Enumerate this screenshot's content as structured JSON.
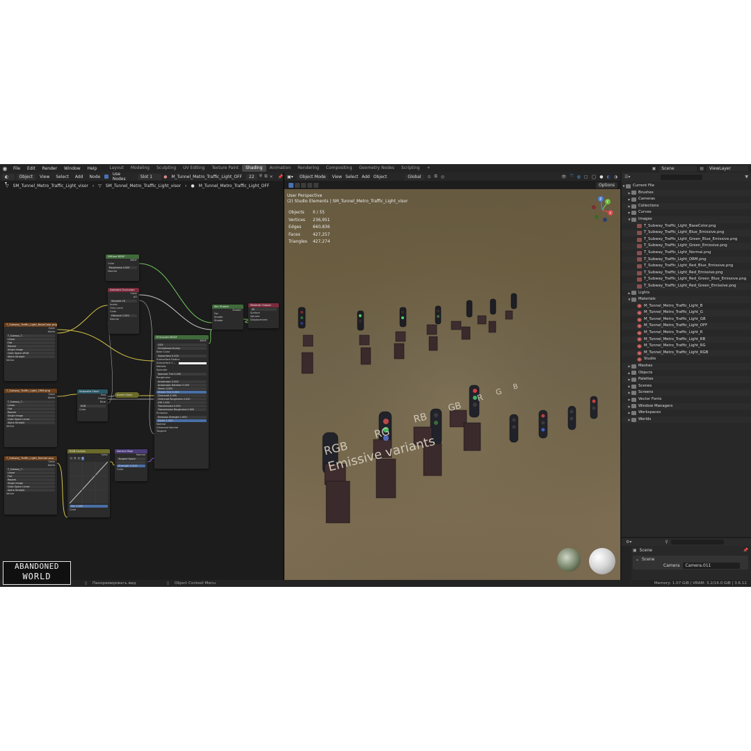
{
  "app": {
    "menus": [
      "File",
      "Edit",
      "Render",
      "Window",
      "Help"
    ],
    "workspaces": [
      "Layout",
      "Modeling",
      "Sculpting",
      "UV Editing",
      "Texture Paint",
      "Shading",
      "Animation",
      "Rendering",
      "Compositing",
      "Geometry Nodes",
      "Scripting"
    ],
    "active_workspace": "Shading",
    "add_tab": "+",
    "scene": "Scene",
    "view_layer": "ViewLayer"
  },
  "node_editor": {
    "header": {
      "mode": "Object",
      "view": "View",
      "select": "Select",
      "add": "Add",
      "node": "Node",
      "use_nodes": "Use Nodes",
      "slot": "Slot 1",
      "material": "M_Tunnel_Metro_Traffic_Light_OFF",
      "users": "22"
    },
    "breadcrumbs": [
      "SM_Tunnel_Metro_Traffic_Light_visor",
      "SM_Tunnel_Metro_Traffic_Light_visor",
      "M_Tunnel_Metro_Traffic_Light_OFF"
    ],
    "nodes": {
      "diffuse": {
        "title": "Diffuse BSDF",
        "out": "BSDF",
        "rows": [
          "Color",
          "Roughness   0.000",
          "Normal"
        ]
      },
      "ao": {
        "title": "Ambient Occlusion",
        "out1": "Color",
        "out2": "AO",
        "rows": [
          "Samples   16",
          "Inside",
          "Only Local",
          "Color",
          "Distance   1.000",
          "Normal"
        ]
      },
      "mix": {
        "title": "Mix Shader",
        "out": "Shader",
        "rows": [
          "Fac",
          "Shader",
          "Shader"
        ]
      },
      "output": {
        "title": "Material Output",
        "target": "All",
        "rows": [
          "Surface",
          "Volume",
          "Displacement"
        ]
      },
      "tex_base": {
        "title": "T_Subway_Traffic_Light_BaseColor.png",
        "out1": "Color",
        "out2": "Alpha",
        "file": "T_Subway_T...",
        "rows": [
          "Linear",
          "Flat",
          "Repeat",
          "Single Image",
          "Color Space   sRGB",
          "Alpha   Straight",
          "Vector"
        ]
      },
      "tex_orm": {
        "title": "T_Subway_Traffic_Light_ORM.png",
        "out1": "Color",
        "out2": "Alpha",
        "file": "T_Subway_T...",
        "rows": [
          "Linear",
          "Flat",
          "Repeat",
          "Single Image",
          "Color Space   Linear",
          "Alpha   Straight",
          "Vector"
        ]
      },
      "tex_normal": {
        "title": "T_Subway_Traffic_Light_Normal.png",
        "out1": "Color",
        "out2": "Alpha",
        "file": "T_Subway_T...",
        "rows": [
          "Linear",
          "Flat",
          "Repeat",
          "Single Image",
          "Color Space   Linear",
          "Alpha   Straight",
          "Vector"
        ]
      },
      "separate": {
        "title": "Separate Color",
        "rows": [
          "Red",
          "Green",
          "Blue",
          "RGB",
          "Color"
        ]
      },
      "invert": {
        "title": "Invert Color"
      },
      "rgbcurves": {
        "title": "RGB Curves",
        "out": "Color",
        "fac": "Fac   1.000",
        "color": "Color"
      },
      "normalmap": {
        "title": "Normal Map",
        "out": "Normal",
        "space": "Tangent Space",
        "strength": "Strength   1.000",
        "color": "Color"
      },
      "principled": {
        "title": "Principled BSDF",
        "out": "BSDF",
        "rows": [
          "GGX",
          "Christensen-Burley",
          "Base Color",
          "Subsurface   0.000",
          "Subsurface Radius",
          "Subsurface C...",
          "Metallic",
          "Specular",
          "Specular Tint   0.000",
          "Roughness",
          "Anisotropic   0.000",
          "Anisotropic Rotation   0.000",
          "Sheen   0.000",
          "Sheen Tint   0.500",
          "Clearcoat   0.000",
          "Clearcoat Roughness   0.030",
          "IOR   1.450",
          "Transmission   0.000",
          "Transmission Roughness   0.000",
          "Emission",
          "Emission Strength   1.000",
          "Alpha   1.000",
          "Normal",
          "Clearcoat Normal",
          "Tangent"
        ]
      }
    }
  },
  "viewport": {
    "mode": "Object Mode",
    "view": "View",
    "select": "Select",
    "add": "Add",
    "object": "Object",
    "orientation": "Global",
    "options": "Options",
    "perspective": "User Perspective",
    "collection_line": "(2) Studio Elements | SM_Tunnel_Metro_Traffic_Light_visor",
    "stats": [
      {
        "label": "Objects",
        "value": "0 / 55"
      },
      {
        "label": "Vertices",
        "value": "236,951"
      },
      {
        "label": "Edges",
        "value": "660,836"
      },
      {
        "label": "Faces",
        "value": "427,257"
      },
      {
        "label": "Triangles",
        "value": "427,274"
      }
    ],
    "scene_text": {
      "variants_top": [
        "RGB",
        "RG",
        "RB",
        "GB",
        "R",
        "G",
        "B"
      ],
      "caption": "Emissive variants"
    },
    "gizmo_axes": [
      "X",
      "Y",
      "Z"
    ]
  },
  "outliner": {
    "root": "Current File",
    "tree": [
      {
        "label": "Brushes",
        "level": 1,
        "type": "grp",
        "expanded": false
      },
      {
        "label": "Cameras",
        "level": 1,
        "type": "grp",
        "expanded": false
      },
      {
        "label": "Collections",
        "level": 1,
        "type": "grp",
        "expanded": false
      },
      {
        "label": "Curves",
        "level": 1,
        "type": "grp",
        "expanded": false
      },
      {
        "label": "Images",
        "level": 1,
        "type": "grp",
        "expanded": true
      },
      {
        "label": "T_Subway_Traffic_Light_BaseColor.png",
        "level": 2,
        "type": "img"
      },
      {
        "label": "T_Subway_Traffic_Light_Blue_Emissive.png",
        "level": 2,
        "type": "img"
      },
      {
        "label": "T_Subway_Traffic_Light_Green_Blue_Emissive.png",
        "level": 2,
        "type": "img"
      },
      {
        "label": "T_Subway_Traffic_Light_Green_Emissive.png",
        "level": 2,
        "type": "img"
      },
      {
        "label": "T_Subway_Traffic_Light_Normal.png",
        "level": 2,
        "type": "img"
      },
      {
        "label": "T_Subway_Traffic_Light_ORM.png",
        "level": 2,
        "type": "img"
      },
      {
        "label": "T_Subway_Traffic_Light_Red_Blue_Emissive.png",
        "level": 2,
        "type": "img"
      },
      {
        "label": "T_Subway_Traffic_Light_Red_Emissive.png",
        "level": 2,
        "type": "img"
      },
      {
        "label": "T_Subway_Traffic_Light_Red_Green_Blue_Emissive.png",
        "level": 2,
        "type": "img"
      },
      {
        "label": "T_Subway_Traffic_Light_Red_Green_Emissive.png",
        "level": 2,
        "type": "img"
      },
      {
        "label": "Lights",
        "level": 1,
        "type": "grp",
        "expanded": false
      },
      {
        "label": "Materials",
        "level": 1,
        "type": "grp",
        "expanded": true
      },
      {
        "label": "M_Tunnel_Metro_Traffic_Light_B",
        "level": 2,
        "type": "mat"
      },
      {
        "label": "M_Tunnel_Metro_Traffic_Light_G",
        "level": 2,
        "type": "mat"
      },
      {
        "label": "M_Tunnel_Metro_Traffic_Light_GB",
        "level": 2,
        "type": "mat"
      },
      {
        "label": "M_Tunnel_Metro_Traffic_Light_OFF",
        "level": 2,
        "type": "mat"
      },
      {
        "label": "M_Tunnel_Metro_Traffic_Light_R",
        "level": 2,
        "type": "mat"
      },
      {
        "label": "M_Tunnel_Metro_Traffic_Light_RB",
        "level": 2,
        "type": "mat"
      },
      {
        "label": "M_Tunnel_Metro_Traffic_Light_RG",
        "level": 2,
        "type": "mat"
      },
      {
        "label": "M_Tunnel_Metro_Traffic_Light_RGB",
        "level": 2,
        "type": "mat"
      },
      {
        "label": "Studio",
        "level": 2,
        "type": "mat"
      },
      {
        "label": "Meshes",
        "level": 1,
        "type": "grp",
        "expanded": false
      },
      {
        "label": "Objects",
        "level": 1,
        "type": "grp",
        "expanded": false
      },
      {
        "label": "Palettes",
        "level": 1,
        "type": "grp",
        "expanded": false
      },
      {
        "label": "Scenes",
        "level": 1,
        "type": "grp",
        "expanded": false
      },
      {
        "label": "Screens",
        "level": 1,
        "type": "grp",
        "expanded": false
      },
      {
        "label": "Vector Fonts",
        "level": 1,
        "type": "grp",
        "expanded": false
      },
      {
        "label": "Window Managers",
        "level": 1,
        "type": "grp",
        "expanded": false
      },
      {
        "label": "Workspaces",
        "level": 1,
        "type": "grp",
        "expanded": false
      },
      {
        "label": "Worlds",
        "level": 1,
        "type": "grp",
        "expanded": false
      }
    ]
  },
  "properties": {
    "context": "Scene",
    "panel": "Scene",
    "camera_label": "Camera",
    "camera_value": "Camera.011"
  },
  "statusbar": {
    "pan": "Панорамировать вид",
    "context_menu": "Object Context Menu",
    "memory": "Memory: 1.07 GiB | VRAM: 3.2/16.0 GiB | 3.6.12"
  },
  "watermark": {
    "line1": "ABANDONED",
    "line2": "WORLD"
  }
}
